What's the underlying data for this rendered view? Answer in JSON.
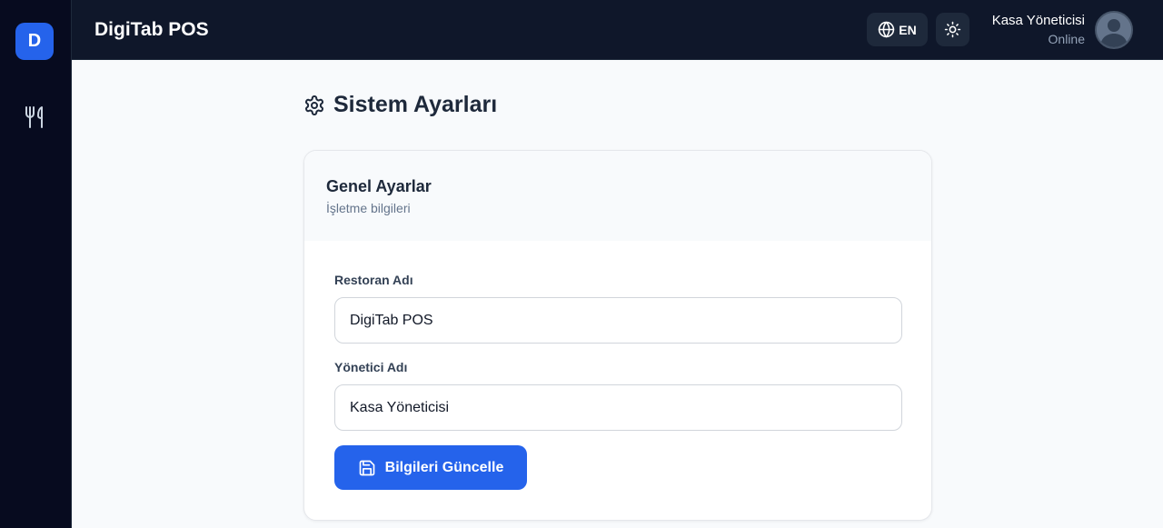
{
  "sidebar": {
    "logo_letter": "D",
    "items": [
      {
        "icon": "utensils-icon"
      }
    ]
  },
  "header": {
    "title": "DigiTab POS",
    "language": "EN",
    "user_name": "Kasa Yöneticisi",
    "user_status": "Online"
  },
  "page": {
    "title": "Sistem Ayarları",
    "icon": "settings-gear-icon"
  },
  "card": {
    "title": "Genel Ayarlar",
    "subtitle": "İşletme bilgileri",
    "fields": [
      {
        "label": "Restoran Adı",
        "value": "DigiTab POS"
      },
      {
        "label": "Yönetici Adı",
        "value": "Kasa Yöneticisi"
      }
    ],
    "submit_label": "Bilgileri Güncelle"
  },
  "colors": {
    "sidebar_bg": "#070b1f",
    "header_bg": "#0f172a",
    "accent": "#2563eb",
    "page_bg": "#f8fafc"
  }
}
